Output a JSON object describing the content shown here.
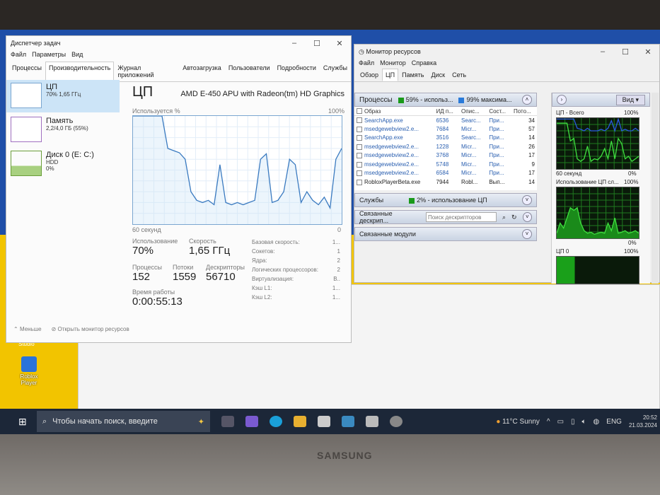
{
  "task_manager": {
    "title": "Диспетчер задач",
    "menu": [
      "Файл",
      "Параметры",
      "Вид"
    ],
    "tabs": [
      "Процессы",
      "Производительность",
      "Журнал приложений",
      "Автозагрузка",
      "Пользователи",
      "Подробности",
      "Службы"
    ],
    "active_tab": "Производительность",
    "sidebar": [
      {
        "name": "ЦП",
        "detail": "70% 1,65 ГГц"
      },
      {
        "name": "Память",
        "detail": "2,2/4,0 ГБ (55%)"
      },
      {
        "name": "Диск 0 (E: C:)",
        "detail": "HDD",
        "detail2": "0%"
      }
    ],
    "cpu": {
      "heading": "ЦП",
      "model": "AMD E-450 APU with Radeon(tm) HD Graphics",
      "graph_label": "Используется %",
      "graph_max": "100%",
      "graph_time": "60 секунд",
      "graph_min": "0",
      "usage_label": "Использование",
      "usage": "70%",
      "speed_label": "Скорость",
      "speed": "1,65 ГГц",
      "processes_label": "Процессы",
      "processes": "152",
      "threads_label": "Потоки",
      "threads": "1559",
      "handles_label": "Дескрипторы",
      "handles": "56710",
      "uptime_label": "Время работы",
      "uptime": "0:00:55:13",
      "specs": [
        {
          "k": "Базовая скорость:",
          "v": "1..."
        },
        {
          "k": "Сокетов:",
          "v": "1"
        },
        {
          "k": "Ядра:",
          "v": "2"
        },
        {
          "k": "Логических процессоров:",
          "v": "2"
        },
        {
          "k": "Виртуализация:",
          "v": "В.."
        },
        {
          "k": "Кэш L1:",
          "v": "1..."
        },
        {
          "k": "Кэш L2:",
          "v": "1..."
        }
      ],
      "history": [
        100,
        100,
        100,
        100,
        100,
        100,
        70,
        68,
        66,
        60,
        30,
        22,
        20,
        22,
        18,
        55,
        20,
        18,
        20,
        18,
        20,
        22,
        60,
        65,
        20,
        22,
        30,
        60,
        55,
        20,
        30,
        22,
        18,
        25,
        15,
        60,
        70
      ]
    },
    "footer": {
      "less": "Меньше",
      "open_rm": "Открыть монитор ресурсов"
    }
  },
  "resource_monitor": {
    "title": "Монитор ресурсов",
    "menu": [
      "Файл",
      "Монитор",
      "Справка"
    ],
    "tabs": [
      "Обзор",
      "ЦП",
      "Память",
      "Диск",
      "Сеть"
    ],
    "active_tab": "ЦП",
    "processes": {
      "title": "Процессы",
      "usage": "59% - использ...",
      "max": "99% максима...",
      "columns": [
        "Образ",
        "ИД п...",
        "Опис...",
        "Сост...",
        "Пото..."
      ],
      "rows": [
        [
          "SearchApp.exe",
          "6536",
          "Searc...",
          "При...",
          "34"
        ],
        [
          "msedgewebview2.e...",
          "7684",
          "Micr...",
          "При...",
          "57"
        ],
        [
          "SearchApp.exe",
          "3516",
          "Searc...",
          "При...",
          "14"
        ],
        [
          "msedgewebview2.e...",
          "1228",
          "Micr...",
          "При...",
          "26"
        ],
        [
          "msedgewebview2.e...",
          "3768",
          "Micr...",
          "При...",
          "17"
        ],
        [
          "msedgewebview2.e...",
          "5748",
          "Micr...",
          "При...",
          "9"
        ],
        [
          "msedgewebview2.e...",
          "6584",
          "Micr...",
          "При...",
          "17"
        ],
        [
          "RobloxPlayerBeta.exe",
          "7944",
          "Robl...",
          "Вып...",
          "14"
        ]
      ]
    },
    "services": {
      "title": "Службы",
      "usage": "2% - использование ЦП"
    },
    "handles": {
      "title": "Связанные дескрип...",
      "placeholder": "Поиск дескрипторов"
    },
    "modules": {
      "title": "Связанные модули"
    },
    "graphs": {
      "view": "Вид",
      "total": {
        "title": "ЦП - Всего",
        "max": "100%",
        "time": "60 секунд",
        "min": "0%",
        "green": [
          90,
          90,
          90,
          90,
          55,
          60,
          20,
          15,
          20,
          45,
          15,
          20,
          18,
          25,
          40,
          20,
          55,
          20,
          60,
          50,
          20,
          25,
          15,
          20,
          25
        ],
        "blue": [
          98,
          98,
          98,
          98,
          98,
          98,
          80,
          78,
          75,
          80,
          75,
          75,
          75,
          78,
          75,
          80,
          95,
          75,
          98,
          75,
          78,
          75,
          75,
          80,
          75
        ]
      },
      "service": {
        "title": "Использование ЦП сл...",
        "max": "100%",
        "min": "0%",
        "green": [
          10,
          30,
          20,
          40,
          60,
          55,
          60,
          30,
          15,
          10,
          12,
          8,
          10,
          12,
          10,
          30,
          15,
          40,
          10,
          12,
          15,
          10,
          12,
          15,
          10
        ]
      },
      "cpu0": {
        "title": "ЦП 0",
        "max": "100%"
      }
    }
  },
  "desktop": {
    "icon_label": "Roblox Player",
    "icon_above": "Studio"
  },
  "taskbar": {
    "search_placeholder": "Чтобы начать поиск, введите",
    "weather": "11°C  Sunny",
    "lang": "ENG",
    "time": "20:52",
    "date": "21.03.2024"
  },
  "laptop": {
    "brand": "SAMSUNG"
  }
}
